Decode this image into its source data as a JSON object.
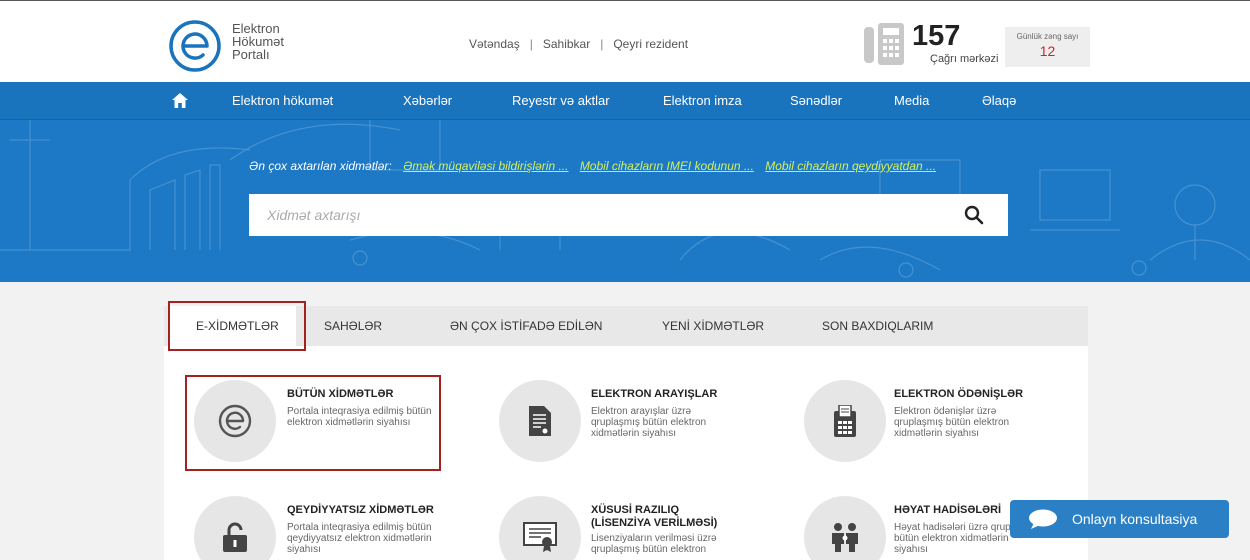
{
  "header": {
    "logo_lines": [
      "Elektron",
      "Hökumət",
      "Portalı"
    ],
    "audience": [
      "Vətəndaş",
      "Sahibkar",
      "Qeyri rezident"
    ],
    "call_center_number": "157",
    "call_center_label": "Çağrı mərkəzi",
    "daily_calls_label": "Günlük zəng sayı",
    "daily_calls_value": "12"
  },
  "nav": {
    "items": [
      "Elektron hökumət",
      "Xəbərlər",
      "Reyestr və aktlar",
      "Elektron imza",
      "Sənədlər",
      "Media",
      "Əlaqə"
    ]
  },
  "hero": {
    "popular_label": "Ən çox axtarılan xidmətlər:",
    "popular_links": [
      "Əmək müqaviləsi bildirişlərin ...",
      "Mobil cihazların IMEI kodunun ...",
      "Mobil cihazların qeydiyyatdan ..."
    ],
    "search_placeholder": "Xidmət axtarışı"
  },
  "tabs": [
    "E-XİDMƏTLƏR",
    "SAHƏLƏR",
    "ƏN ÇOX İSTİFADƏ EDİLƏN",
    "YENİ XİDMƏTLƏR",
    "SON BAXDIQLARIM"
  ],
  "services": [
    {
      "title": "BÜTÜN XİDMƏTLƏR",
      "desc": "Portala inteqrasiya edilmiş bütün elektron xidmətlərin siyahısı",
      "icon": "e-logo-icon"
    },
    {
      "title": "ELEKTRON ARAYIŞLAR",
      "desc": "Elektron arayışlar üzrə qruplaşmış bütün elektron xidmətlərin siyahısı",
      "icon": "document-icon"
    },
    {
      "title": "ELEKTRON ÖDƏNİŞLƏR",
      "desc": "Elektron ödənişlər üzrə qruplaşmış bütün elektron xidmətlərin siyahısı",
      "icon": "payment-terminal-icon"
    },
    {
      "title": "QEYDİYYATSIZ XİDMƏTLƏR",
      "desc": "Portala inteqrasiya edilmiş bütün qeydiyyatsız elektron xidmətlərin siyahısı",
      "icon": "unlock-icon"
    },
    {
      "title_lines": [
        "XÜSUSİ RAZILIQ",
        "(LİSENZİYA VERİLMƏSİ)"
      ],
      "desc": "Lisenziyaların verilməsi üzrə qruplaşmış bütün elektron",
      "icon": "certificate-icon"
    },
    {
      "title": "HƏYAT HADİSƏLƏRİ",
      "desc": "Həyat hadisələri üzrə qruplaşmış bütün elektron xidmətlərin siyahısı",
      "icon": "family-icon"
    }
  ],
  "chat": {
    "label": "Onlayn konsultasiya"
  },
  "colors": {
    "nav_blue": "#1a73bd",
    "hero_blue": "#1d79c5",
    "link_yellow": "#d6f05c",
    "highlight_red": "#a32121",
    "chat_blue": "#2b7fc4"
  }
}
